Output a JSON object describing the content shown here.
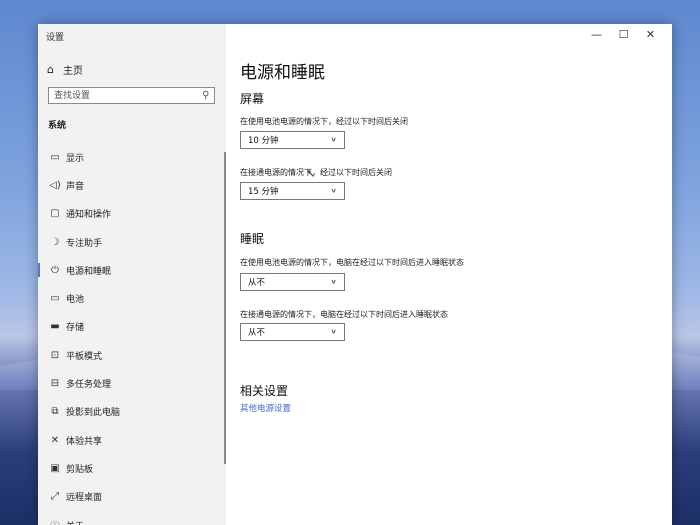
{
  "window": {
    "title": "设置"
  },
  "window_controls": {
    "minimize": "—",
    "maximize": "☐",
    "close": "✕"
  },
  "sidebar": {
    "home_label": "主页",
    "search_placeholder": "查找设置",
    "section_label": "系统",
    "items": [
      {
        "label": "显示",
        "icon": "monitor-icon"
      },
      {
        "label": "声音",
        "icon": "speaker-icon"
      },
      {
        "label": "通知和操作",
        "icon": "notification-icon"
      },
      {
        "label": "专注助手",
        "icon": "moon-icon"
      },
      {
        "label": "电源和睡眠",
        "icon": "power-icon",
        "active": true
      },
      {
        "label": "电池",
        "icon": "battery-icon"
      },
      {
        "label": "存储",
        "icon": "storage-icon"
      },
      {
        "label": "平板模式",
        "icon": "tablet-icon"
      },
      {
        "label": "多任务处理",
        "icon": "multitask-icon"
      },
      {
        "label": "投影到此电脑",
        "icon": "project-icon"
      },
      {
        "label": "体验共享",
        "icon": "share-icon"
      },
      {
        "label": "剪贴板",
        "icon": "clipboard-icon"
      },
      {
        "label": "远程桌面",
        "icon": "remote-desktop-icon"
      },
      {
        "label": "关于",
        "icon": "info-icon"
      }
    ]
  },
  "main": {
    "page_title": "电源和睡眠",
    "screen": {
      "heading": "屏幕",
      "battery_desc": "在使用电池电源的情况下，经过以下时间后关闭",
      "battery_value": "10 分钟",
      "plugged_desc": "在接通电源的情况下，经过以下时间后关闭",
      "plugged_value": "15 分钟"
    },
    "sleep": {
      "heading": "睡眠",
      "battery_desc": "在使用电池电源的情况下，电脑在经过以下时间后进入睡眠状态",
      "battery_value": "从不",
      "plugged_desc": "在接通电源的情况下，电脑在经过以下时间后进入睡眠状态",
      "plugged_value": "从不"
    },
    "related": {
      "heading": "相关设置",
      "link": "其他电源设置"
    }
  }
}
